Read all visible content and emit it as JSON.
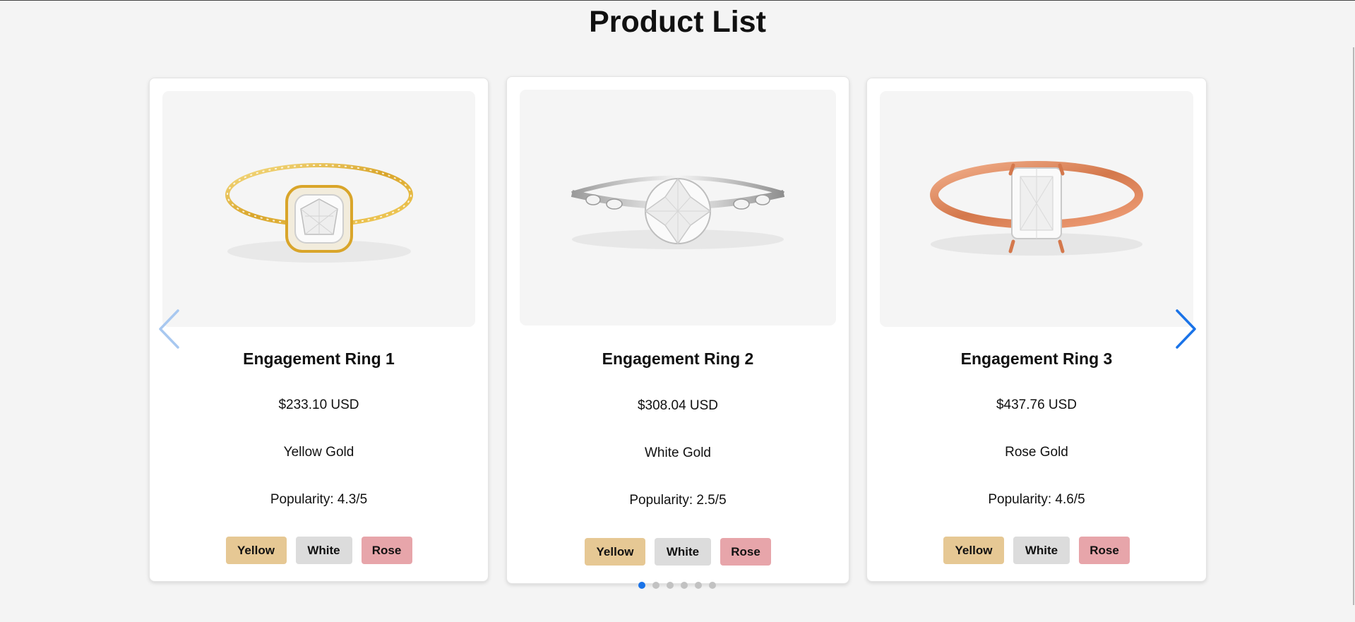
{
  "page": {
    "title": "Product List"
  },
  "carousel": {
    "prev_icon": "chevron-left-icon",
    "next_icon": "chevron-right-icon",
    "accent_color": "#1a73e8",
    "dots_total": 6,
    "active_dot": 0
  },
  "products": [
    {
      "name": "Engagement Ring 1",
      "price": "$233.10 USD",
      "metal": "Yellow Gold",
      "popularity": "Popularity: 4.3/5",
      "image": "yellow-gold-halo-ring"
    },
    {
      "name": "Engagement Ring 2",
      "price": "$308.04 USD",
      "metal": "White Gold",
      "popularity": "Popularity: 2.5/5",
      "image": "white-gold-round-ring"
    },
    {
      "name": "Engagement Ring 3",
      "price": "$437.76 USD",
      "metal": "Rose Gold",
      "popularity": "Popularity: 4.6/5",
      "image": "rose-gold-emerald-ring"
    }
  ],
  "swatches": {
    "yellow_label": "Yellow",
    "white_label": "White",
    "rose_label": "Rose",
    "yellow_color": "#e6c894",
    "white_color": "#dcdcdc",
    "rose_color": "#e7a5aa"
  }
}
